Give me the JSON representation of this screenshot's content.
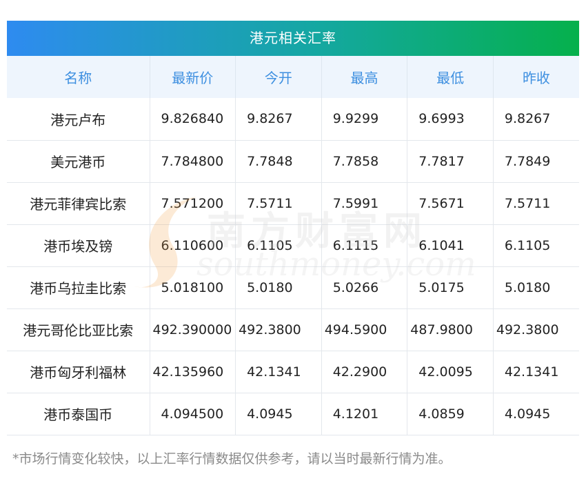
{
  "title": "港元相关汇率",
  "headers": [
    "名称",
    "最新价",
    "今开",
    "最高",
    "最低",
    "昨收"
  ],
  "rows": [
    {
      "name": "港元卢布",
      "latest": "9.826840",
      "open": "9.8267",
      "high": "9.9299",
      "low": "9.6993",
      "prev_close": "9.8267"
    },
    {
      "name": "美元港币",
      "latest": "7.784800",
      "open": "7.7848",
      "high": "7.7858",
      "low": "7.7817",
      "prev_close": "7.7849"
    },
    {
      "name": "港元菲律宾比索",
      "latest": "7.571200",
      "open": "7.5711",
      "high": "7.5991",
      "low": "7.5671",
      "prev_close": "7.5711"
    },
    {
      "name": "港币埃及镑",
      "latest": "6.110600",
      "open": "6.1105",
      "high": "6.1115",
      "low": "6.1041",
      "prev_close": "6.1105"
    },
    {
      "name": "港币乌拉圭比索",
      "latest": "5.018100",
      "open": "5.0180",
      "high": "5.0266",
      "low": "5.0175",
      "prev_close": "5.0180"
    },
    {
      "name": "港元哥伦比亚比索",
      "latest": "492.390000",
      "open": "492.3800",
      "high": "494.5900",
      "low": "487.9800",
      "prev_close": "492.3800"
    },
    {
      "name": "港币匈牙利福林",
      "latest": "42.135960",
      "open": "42.1341",
      "high": "42.2900",
      "low": "42.0095",
      "prev_close": "42.1341"
    },
    {
      "name": "港币泰国币",
      "latest": "4.094500",
      "open": "4.0945",
      "high": "4.1201",
      "low": "4.0859",
      "prev_close": "4.0945"
    }
  ],
  "footnote": "*市场行情变化较快，以上汇率行情数据仅供参考，请以当时最新行情为准。",
  "watermark": {
    "cn": "南方财富网",
    "en": "southmoney.com"
  },
  "colors": {
    "title_gradient_start": "#2e8bf0",
    "title_gradient_end": "#05b04c",
    "header_text": "#3d8fe0",
    "header_bg": "#eef5fd"
  }
}
